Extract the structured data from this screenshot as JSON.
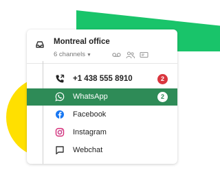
{
  "inbox": {
    "title": "Montreal office",
    "channels_summary": "6 channels",
    "caret_icon": "caret-down-icon",
    "header_icons": [
      "voicemail-icon",
      "users-icon",
      "card-icon"
    ]
  },
  "channels": [
    {
      "name": "phone",
      "label": "+1 438 555 8910",
      "icon": "phone-icon",
      "badge": "2",
      "active": false
    },
    {
      "name": "whatsapp",
      "label": "WhatsApp",
      "icon": "whatsapp-icon",
      "badge": "2",
      "active": true
    },
    {
      "name": "facebook",
      "label": "Facebook",
      "icon": "facebook-icon",
      "badge": "",
      "active": false
    },
    {
      "name": "instagram",
      "label": "Instagram",
      "icon": "instagram-icon",
      "badge": "",
      "active": false
    },
    {
      "name": "webchat",
      "label": "Webchat",
      "icon": "webchat-icon",
      "badge": "",
      "active": false
    }
  ],
  "colors": {
    "active_row": "#2e8b57",
    "badge": "#d9363e",
    "green_decoration": "#19c46a",
    "yellow_decoration": "#ffe000",
    "facebook": "#1877f2",
    "instagram": "#d62976"
  }
}
